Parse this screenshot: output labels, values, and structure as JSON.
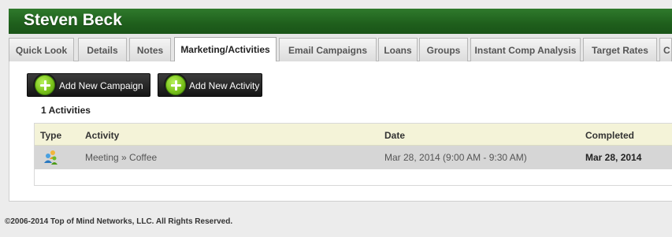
{
  "header": {
    "name": "Steven Beck"
  },
  "tabs": [
    {
      "label": "Quick Look"
    },
    {
      "label": "Details"
    },
    {
      "label": "Notes"
    },
    {
      "label": "Marketing/Activities",
      "active": true
    },
    {
      "label": "Email Campaigns"
    },
    {
      "label": "Loans"
    },
    {
      "label": "Groups"
    },
    {
      "label": "Instant Comp Analysis"
    },
    {
      "label": "Target Rates"
    },
    {
      "label": "C"
    }
  ],
  "actions": {
    "add_campaign": "Add New Campaign",
    "add_activity": "Add New Activity"
  },
  "activities": {
    "count_label": "1 Activities",
    "columns": {
      "type": "Type",
      "activity": "Activity",
      "date": "Date",
      "completed": "Completed"
    },
    "rows": [
      {
        "type_icon": "meeting-people-icon",
        "activity": "Meeting » Coffee",
        "date": "Mar 28, 2014 (9:00 AM - 9:30 AM)",
        "completed": "Mar 28, 2014"
      }
    ]
  },
  "colors": {
    "header_green": "#1f5f1c",
    "header_row": "#f4f3d8",
    "data_row": "#d6d6d6",
    "plus_green": "#7cc41c"
  },
  "footer": {
    "copyright": "©2006-2014 Top of Mind Networks, LLC. All Rights Reserved."
  }
}
